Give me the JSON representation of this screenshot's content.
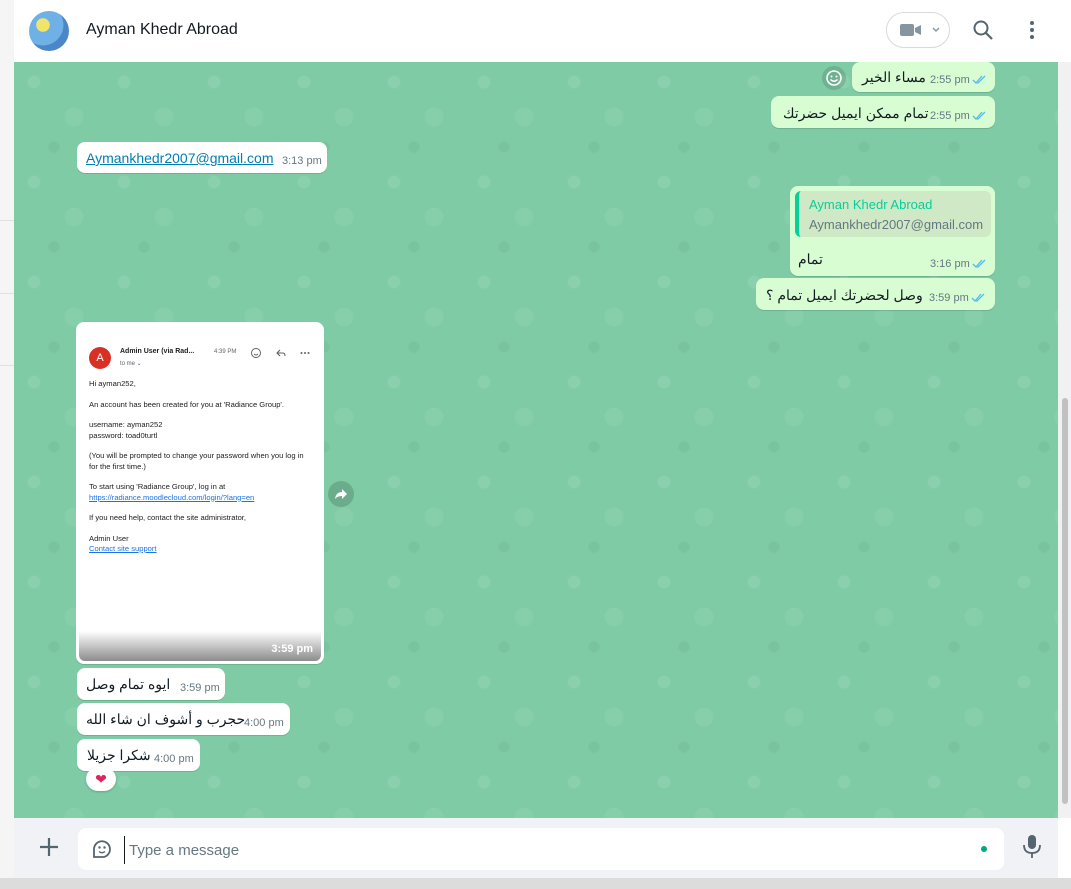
{
  "header": {
    "contact_name": "Ayman Khedr Abroad",
    "icons": [
      "video-call-icon",
      "chevron-down-icon",
      "search-icon",
      "menu-icon"
    ]
  },
  "messages_out": [
    {
      "text": "مساء الخير",
      "time": "2:55 pm"
    },
    {
      "text": "تمام ممكن ايميل حضرتك",
      "time": "2:55 pm"
    },
    {
      "quote_name": "Ayman Khedr Abroad",
      "quote_text": "Aymankhedr2007@gmail.com",
      "text": "تمام",
      "time": "3:16 pm"
    },
    {
      "text": "وصل لحضرتك ايميل تمام ؟",
      "time": "3:59 pm"
    }
  ],
  "messages_in": [
    {
      "text": "Aymankhedr2007@gmail.com",
      "time": "3:13 pm"
    },
    {
      "text": "ايوه تمام وصل",
      "time": "3:59 pm"
    },
    {
      "text": "حجرب و أشوف ان شاء الله",
      "time": "4:00 pm"
    },
    {
      "text": "شكرا جزيلا",
      "time": "4:00 pm"
    }
  ],
  "image_message": {
    "time": "3:59 pm",
    "email": {
      "avatar_letter": "A",
      "from": "Admin User  (via Rad...",
      "to": "to me ⌄",
      "time": "4:39 PM",
      "greeting": "Hi ayman252,",
      "line1": "An account has been created for you at 'Radiance Group'.",
      "username": "username: ayman252",
      "password": "password: toad0turtl",
      "prompt": "(You will be prompted to change your password when you log in for the first time.)",
      "start": "To start using 'Radiance Group', log in at",
      "login_link": "https://radiance.moodlecloud.com/login/?lang=en",
      "help": "If you need help, contact the site administrator,",
      "signoff": "Admin User",
      "contact_link": "Contact site support"
    }
  },
  "reaction": {
    "emoji": "❤"
  },
  "composer": {
    "placeholder": "Type a message"
  },
  "colors": {
    "chat_bg": "#7ecba5",
    "out_bubble": "#d9fdd3",
    "in_bubble": "#ffffff",
    "accent": "#00a884",
    "tick_blue": "#53bdeb"
  }
}
